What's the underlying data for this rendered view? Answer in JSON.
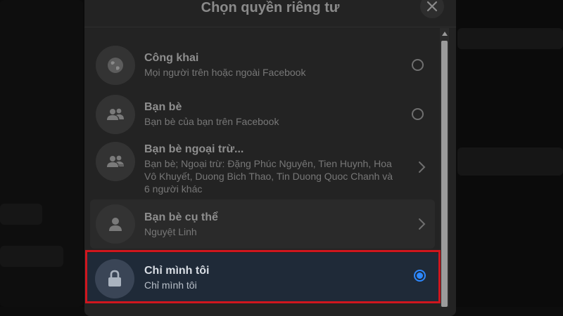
{
  "dialog": {
    "title": "Chọn quyền riêng tư",
    "close_icon": "close-icon"
  },
  "options": [
    {
      "title": "Công khai",
      "subtitle": "Mọi người trên hoặc ngoài Facebook",
      "icon": "globe-icon",
      "control": "radio",
      "selected": false
    },
    {
      "title": "Bạn bè",
      "subtitle": "Bạn bè của bạn trên Facebook",
      "icon": "friends-icon",
      "control": "radio",
      "selected": false
    },
    {
      "title": "Bạn bè ngoại trừ...",
      "subtitle": "Bạn bè; Ngoại trừ: Đặng Phúc Nguyên, Tien Huynh, Hoa Vô Khuyết, Duong Bich Thao, Tin Duong Quoc Chanh và 6 người khác",
      "icon": "friends-except-icon",
      "control": "chevron",
      "selected": false
    },
    {
      "title": "Bạn bè cụ thể",
      "subtitle": "Nguyệt Linh",
      "icon": "person-icon",
      "control": "chevron",
      "selected": false
    },
    {
      "title": "Chỉ mình tôi",
      "subtitle": "Chỉ mình tôi",
      "icon": "lock-icon",
      "control": "radio",
      "selected": true
    }
  ],
  "colors": {
    "accent": "#2d88ff",
    "highlight_box": "#d0161e",
    "dialog_bg": "#232323"
  }
}
